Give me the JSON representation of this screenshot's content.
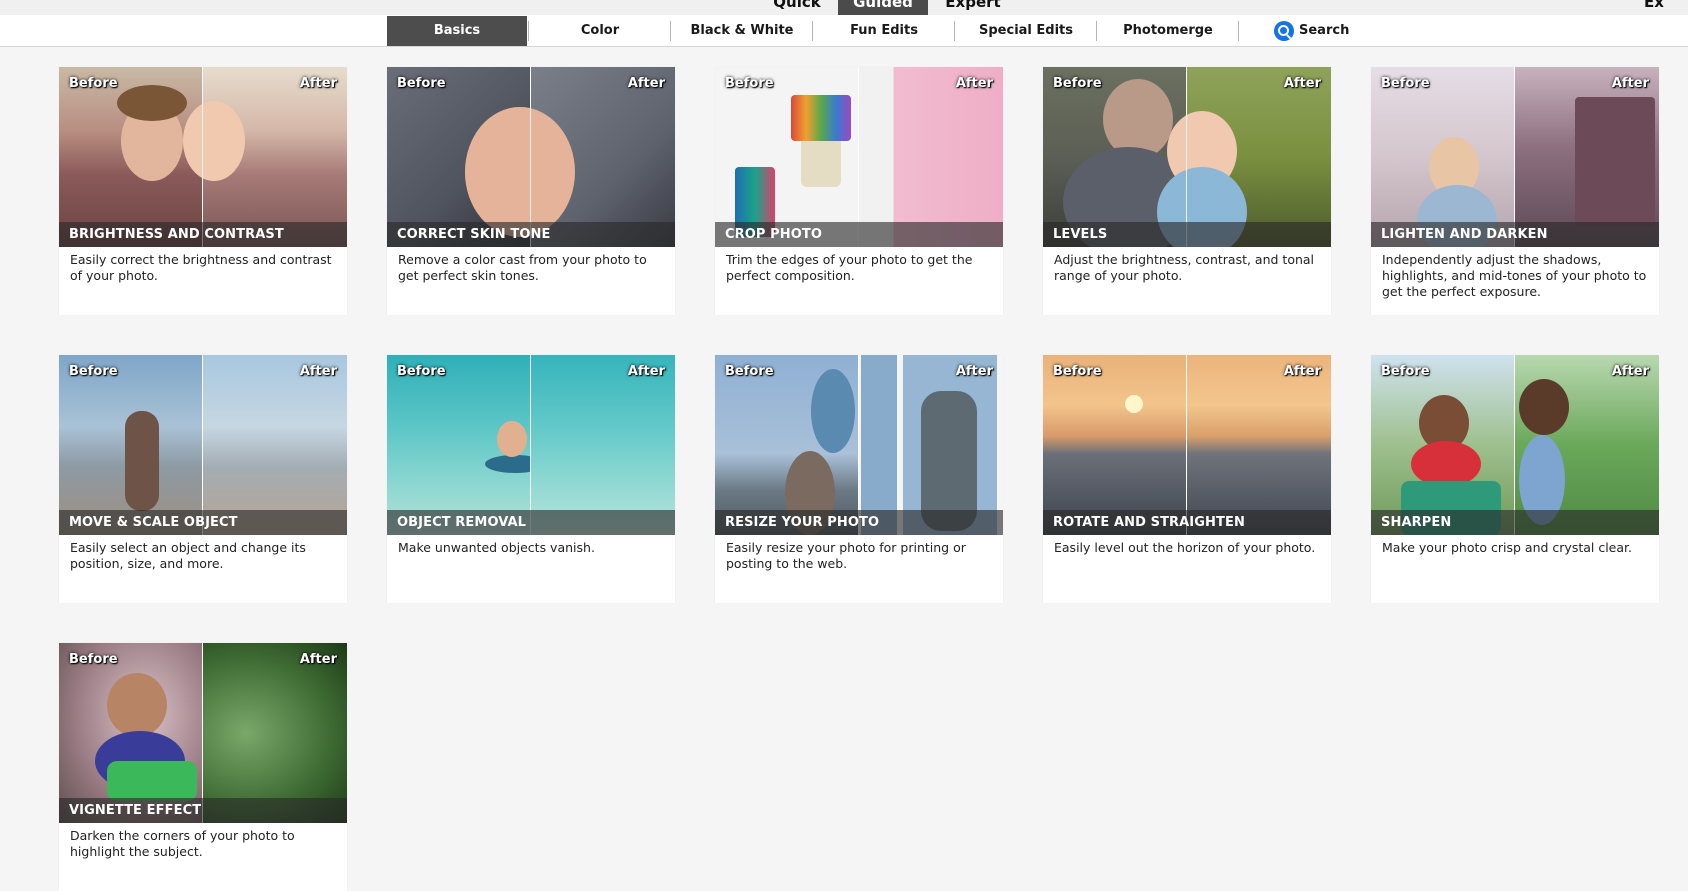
{
  "modes": {
    "quick": "Quick",
    "guided": "Guided",
    "expert": "Expert",
    "user": "Ex"
  },
  "tabs": [
    "Basics",
    "Color",
    "Black & White",
    "Fun Edits",
    "Special Edits",
    "Photomerge"
  ],
  "search_label": "Search",
  "compare": {
    "before": "Before",
    "after": "After"
  },
  "cards": [
    {
      "title": "BRIGHTNESS AND CONTRAST",
      "desc": "Easily correct the brightness and contrast of your photo."
    },
    {
      "title": "CORRECT SKIN TONE",
      "desc": "Remove a color cast from your photo to get perfect skin tones."
    },
    {
      "title": "CROP PHOTO",
      "desc": "Trim the edges of your photo to get the perfect composition."
    },
    {
      "title": "LEVELS",
      "desc": "Adjust the brightness, contrast, and tonal range of your photo."
    },
    {
      "title": "LIGHTEN AND DARKEN",
      "desc": "Independently adjust the shadows, highlights, and mid-tones of your photo to get the perfect exposure."
    },
    {
      "title": "MOVE & SCALE OBJECT",
      "desc": "Easily select an object and change its position, size, and more."
    },
    {
      "title": "OBJECT REMOVAL",
      "desc": "Make unwanted objects vanish."
    },
    {
      "title": "RESIZE YOUR PHOTO",
      "desc": "Easily resize your photo for printing or posting to the web."
    },
    {
      "title": "ROTATE AND STRAIGHTEN",
      "desc": "Easily level out the horizon of your photo."
    },
    {
      "title": "SHARPEN",
      "desc": "Make your photo crisp and crystal clear."
    },
    {
      "title": "VIGNETTE EFFECT",
      "desc": "Darken the corners of your photo to highlight the subject."
    }
  ],
  "colors": {
    "active_tab": "#4d4d4d",
    "search_icon": "#1473e6",
    "background": "#f5f5f5"
  },
  "icons": {
    "search": "search-icon"
  }
}
